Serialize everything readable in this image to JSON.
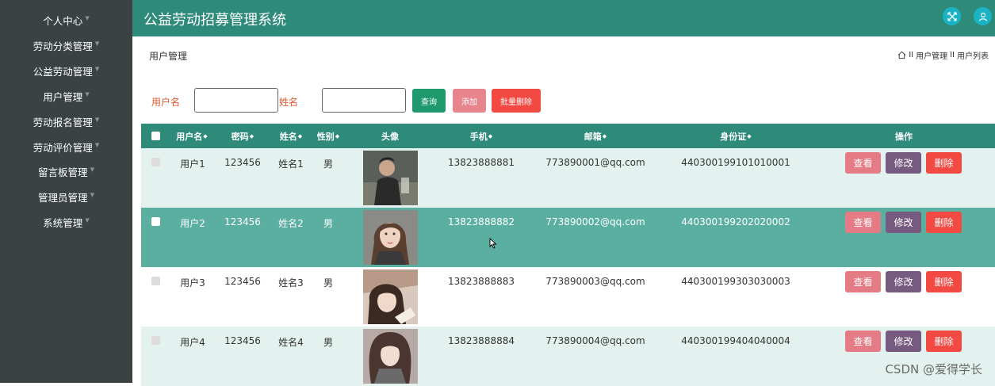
{
  "app": {
    "title": "公益劳动招募管理系统"
  },
  "sidebar": {
    "items": [
      {
        "label": "个人中心"
      },
      {
        "label": "劳动分类管理"
      },
      {
        "label": "公益劳动管理"
      },
      {
        "label": "用户管理"
      },
      {
        "label": "劳动报名管理"
      },
      {
        "label": "劳动评价管理"
      },
      {
        "label": "留言板管理"
      },
      {
        "label": "管理员管理"
      },
      {
        "label": "系统管理"
      }
    ]
  },
  "header": {
    "page_title": "用户管理",
    "breadcrumb": [
      "用户管理",
      "用户列表"
    ],
    "separator": "II"
  },
  "search": {
    "username_label": "用户名",
    "username_value": "",
    "name_label": "姓名",
    "name_value": "",
    "query_label": "查询",
    "add_label": "添加",
    "batch_delete_label": "批量删除"
  },
  "table": {
    "columns": [
      "用户名",
      "密码",
      "姓名",
      "性别",
      "头像",
      "手机",
      "邮箱",
      "身份证",
      "操作"
    ],
    "rows": [
      {
        "username": "用户1",
        "password": "123456",
        "name": "姓名1",
        "gender": "男",
        "phone": "13823888881",
        "email": "773890001@qq.com",
        "id_card": "440300199101010001"
      },
      {
        "username": "用户2",
        "password": "123456",
        "name": "姓名2",
        "gender": "男",
        "phone": "13823888882",
        "email": "773890002@qq.com",
        "id_card": "440300199202020002"
      },
      {
        "username": "用户3",
        "password": "123456",
        "name": "姓名3",
        "gender": "男",
        "phone": "13823888883",
        "email": "773890003@qq.com",
        "id_card": "440300199303030003"
      },
      {
        "username": "用户4",
        "password": "123456",
        "name": "姓名4",
        "gender": "男",
        "phone": "13823888884",
        "email": "773890004@qq.com",
        "id_card": "440300199404040004"
      }
    ],
    "actions": {
      "view": "查看",
      "edit": "修改",
      "delete": "删除"
    }
  },
  "watermark": "CSDN @爱得学长",
  "colors": {
    "primary": "#2e8b7a",
    "sidebar": "#3a4244",
    "row_light": "#e3f2ee",
    "row_hover": "#5aafa1",
    "view": "#e57b85",
    "edit": "#765a7f",
    "delete": "#f24a43"
  }
}
